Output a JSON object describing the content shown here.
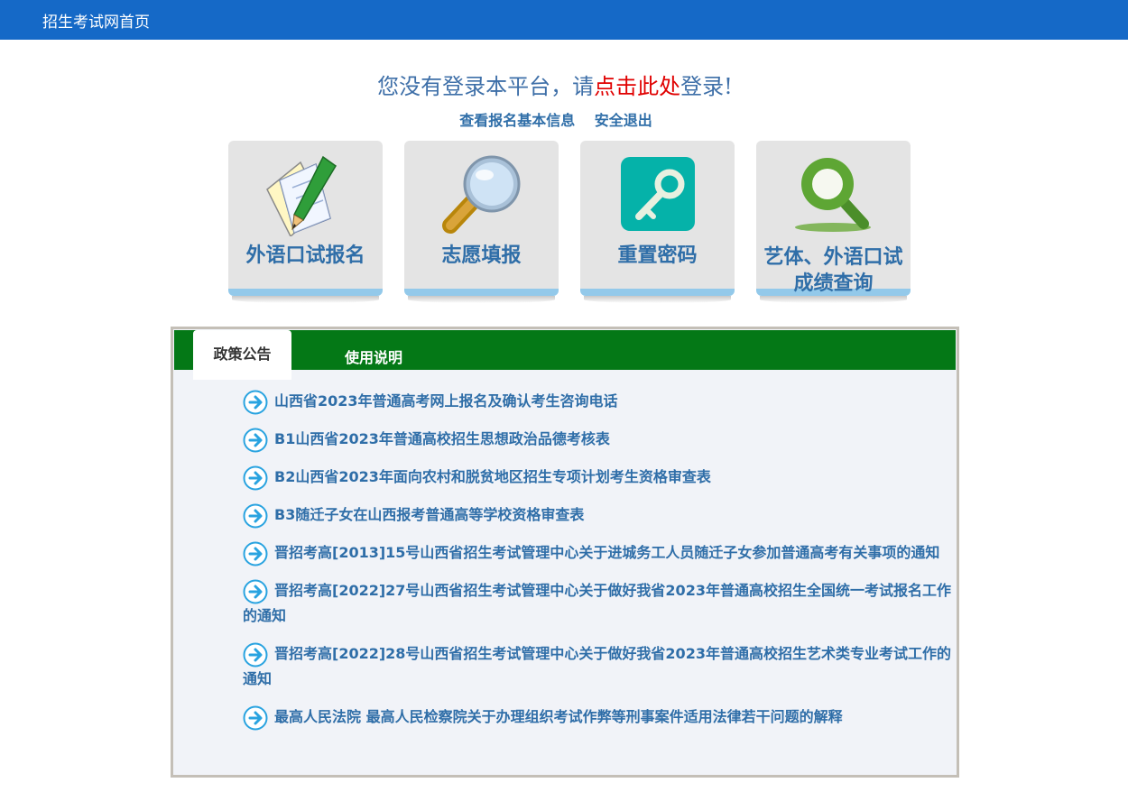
{
  "header": {
    "home_link": "招生考试网首页"
  },
  "login_prompt": {
    "before": "您没有登录本平台，请",
    "link": "点击此处",
    "after": "登录!"
  },
  "top_links": {
    "view_info": "查看报名基本信息",
    "logout": "安全退出"
  },
  "tiles": [
    {
      "label": "外语口试报名",
      "icon": "pen-paper-icon"
    },
    {
      "label": "志愿填报",
      "icon": "magnifier-icon"
    },
    {
      "label": "重置密码",
      "icon": "key-icon"
    },
    {
      "label": "艺体、外语口试成绩查询",
      "icon": "search-icon"
    }
  ],
  "tabs": [
    {
      "label": "政策公告",
      "active": true
    },
    {
      "label": "使用说明",
      "active": false
    }
  ],
  "news": [
    "山西省2023年普通高考网上报名及确认考生咨询电话",
    "B1山西省2023年普通高校招生思想政治品德考核表",
    "B2山西省2023年面向农村和脱贫地区招生专项计划考生资格审查表",
    "B3随迁子女在山西报考普通高等学校资格审查表",
    "晋招考高[2013]15号山西省招生考试管理中心关于进城务工人员随迁子女参加普通高考有关事项的通知",
    "晋招考高[2022]27号山西省招生考试管理中心关于做好我省2023年普通高校招生全国统一考试报名工作的通知",
    "晋招考高[2022]28号山西省招生考试管理中心关于做好我省2023年普通高校招生艺术类专业考试工作的通知",
    "最高人民法院 最高人民检察院关于办理组织考试作弊等刑事案件适用法律若干问题的解释"
  ],
  "colors": {
    "header": "#1569c7",
    "tabbar": "#047816",
    "link": "#2f6ea8",
    "highlight": "#e00000"
  }
}
